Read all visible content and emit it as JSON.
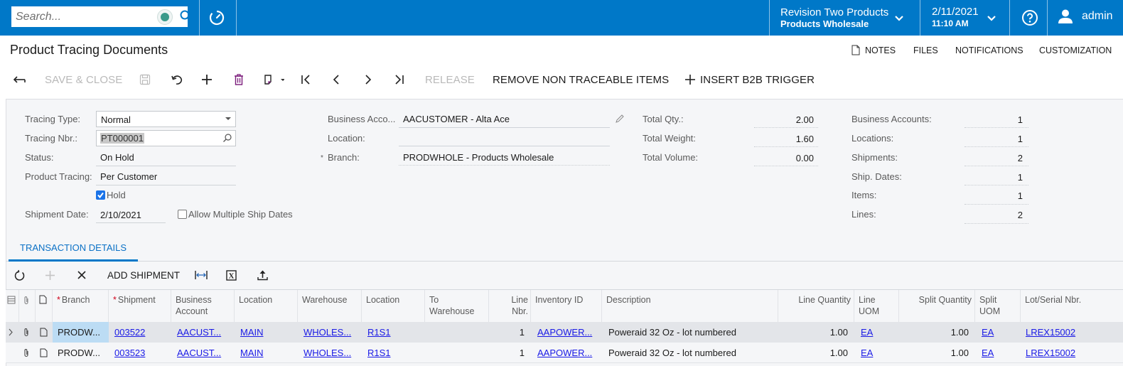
{
  "topbar": {
    "search_placeholder": "Search...",
    "tenant_name": "Revision Two Products",
    "tenant_branch": "Products Wholesale",
    "date": "2/11/2021",
    "time": "11:10 AM",
    "user": "admin"
  },
  "header": {
    "title": "Product Tracing Documents",
    "links": [
      "NOTES",
      "FILES",
      "NOTIFICATIONS",
      "CUSTOMIZATION"
    ]
  },
  "toolbar": {
    "save_close": "SAVE & CLOSE",
    "release": "RELEASE",
    "remove_non_traceable": "REMOVE NON TRACEABLE ITEMS",
    "insert_b2b_trigger": "INSERT B2B TRIGGER"
  },
  "form": {
    "tracing_type": {
      "label": "Tracing Type:",
      "value": "Normal"
    },
    "tracing_nbr": {
      "label": "Tracing Nbr.:",
      "value": "PT000001"
    },
    "status": {
      "label": "Status:",
      "value": "On Hold"
    },
    "product_tracing": {
      "label": "Product Tracing:",
      "value": "Per Customer"
    },
    "hold": {
      "label": "Hold",
      "checked": true
    },
    "shipment_date": {
      "label": "Shipment Date:",
      "value": "2/10/2021"
    },
    "allow_multiple": {
      "label": "Allow Multiple Ship Dates",
      "checked": false
    },
    "business_account": {
      "label": "Business Acco...",
      "value": "AACUSTOMER - Alta Ace"
    },
    "location": {
      "label": "Location:",
      "value": ""
    },
    "branch": {
      "label": "Branch:",
      "value": "PRODWHOLE - Products Wholesale",
      "required_mark": "*"
    },
    "total_qty": {
      "label": "Total Qty.:",
      "value": "2.00"
    },
    "total_weight": {
      "label": "Total Weight:",
      "value": "1.60"
    },
    "total_volume": {
      "label": "Total Volume:",
      "value": "0.00"
    },
    "counts": [
      {
        "label": "Business Accounts:",
        "value": "1"
      },
      {
        "label": "Locations:",
        "value": "1"
      },
      {
        "label": "Shipments:",
        "value": "2"
      },
      {
        "label": "Ship. Dates:",
        "value": "1"
      },
      {
        "label": "Items:",
        "value": "1"
      },
      {
        "label": "Lines:",
        "value": "2"
      }
    ]
  },
  "tabs": [
    {
      "label": "TRANSACTION DETAILS",
      "active": true
    }
  ],
  "grid_toolbar": {
    "add_shipment": "ADD SHIPMENT"
  },
  "grid": {
    "columns": [
      {
        "label": "Branch",
        "required": true
      },
      {
        "label": "Shipment",
        "required": true
      },
      {
        "label": "Business Account"
      },
      {
        "label": "Location"
      },
      {
        "label": "Warehouse"
      },
      {
        "label": "Location"
      },
      {
        "label": "To Warehouse"
      },
      {
        "label": "Line Nbr."
      },
      {
        "label": "Inventory ID"
      },
      {
        "label": "Description"
      },
      {
        "label": "Line Quantity"
      },
      {
        "label": "Line UOM"
      },
      {
        "label": "Split Quantity"
      },
      {
        "label": "Split UOM"
      },
      {
        "label": "Lot/Serial Nbr."
      }
    ],
    "rows": [
      {
        "branch": "PRODW...",
        "shipment": "003522",
        "business_account": "AACUST...",
        "location": "MAIN",
        "warehouse": "WHOLES...",
        "wh_location": "R1S1",
        "to_warehouse": "",
        "line_nbr": "1",
        "inventory_id": "AAPOWER...",
        "description": "Poweraid 32 Oz - lot numbered",
        "line_qty": "1.00",
        "line_uom": "EA",
        "split_qty": "1.00",
        "split_uom": "EA",
        "lot_serial": "LREX15002"
      },
      {
        "branch": "PRODW...",
        "shipment": "003523",
        "business_account": "AACUST...",
        "location": "MAIN",
        "warehouse": "WHOLES...",
        "wh_location": "R1S1",
        "to_warehouse": "",
        "line_nbr": "1",
        "inventory_id": "AAPOWER...",
        "description": "Poweraid 32 Oz - lot numbered",
        "line_qty": "1.00",
        "line_uom": "EA",
        "split_qty": "1.00",
        "split_uom": "EA",
        "lot_serial": "LREX15002"
      }
    ]
  },
  "colors": {
    "brand": "#0078c8",
    "link": "#1a1ae6",
    "required": "#d0021b"
  }
}
